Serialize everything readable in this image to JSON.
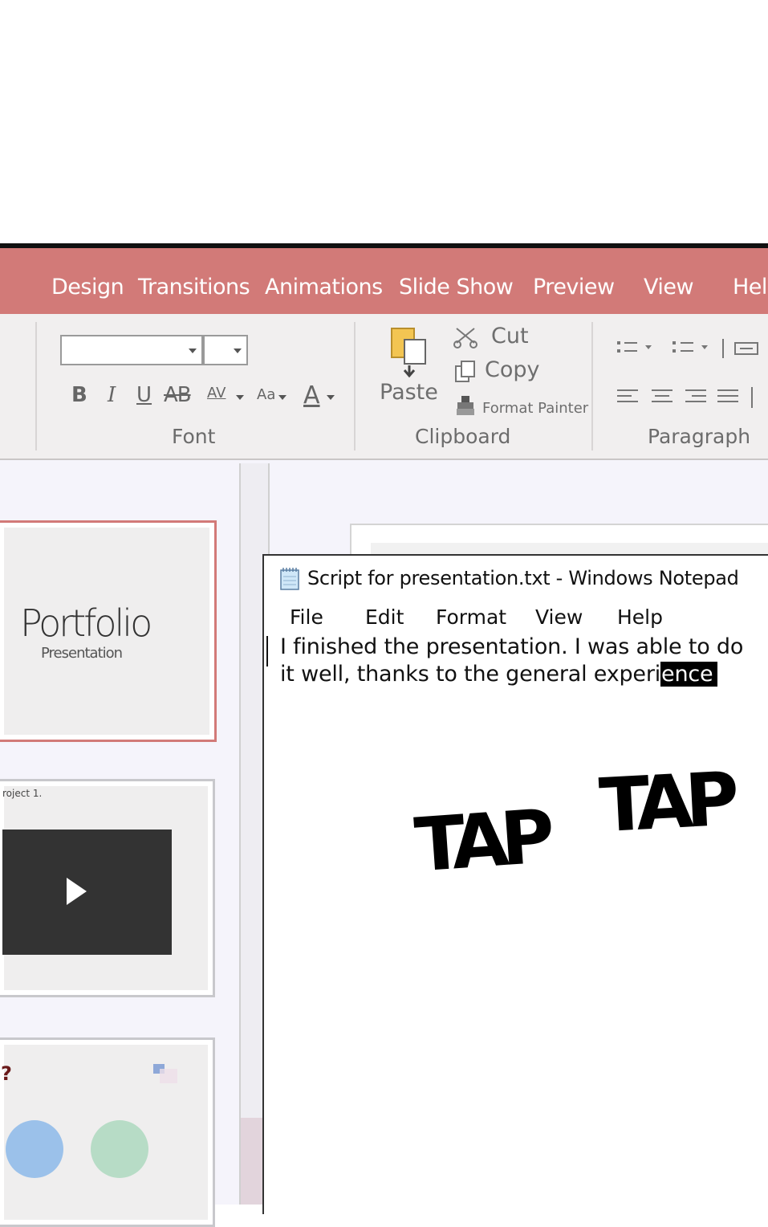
{
  "ribbon": {
    "tabs": [
      "Design",
      "Transitions",
      "Animations",
      "Slide Show",
      "Preview",
      "View",
      "Help"
    ],
    "groups": {
      "font": {
        "label": "Font",
        "buttons": [
          "B",
          "I",
          "U",
          "AB",
          "AV",
          "Aa",
          "A"
        ]
      },
      "clipboard": {
        "label": "Clipboard",
        "paste": "Paste",
        "cut": "Cut",
        "copy": "Copy",
        "format_painter": "Format Painter"
      },
      "paragraph": {
        "label": "Paragraph"
      }
    }
  },
  "slides": {
    "thumb1": {
      "title": "Portfolio",
      "subtitle": "Presentation"
    },
    "thumb2": {
      "caption": "roject 1."
    },
    "thumb3": {
      "mark": "?"
    }
  },
  "notepad": {
    "title": "Script for presentation.txt - Windows Notepad",
    "menu": [
      "File",
      "Edit",
      "Format",
      "View",
      "Help"
    ],
    "line1": "I finished the presentation. I was able to do",
    "line2_plain": "it well, thanks to the general experi",
    "line2_selected": "ence"
  },
  "sfx": [
    "TAP",
    "TAP"
  ],
  "colors": {
    "accent": "#d27a78",
    "play_tile": "#333333",
    "circle_blue": "#9bc1ea",
    "circle_green": "#b7dcc6"
  }
}
